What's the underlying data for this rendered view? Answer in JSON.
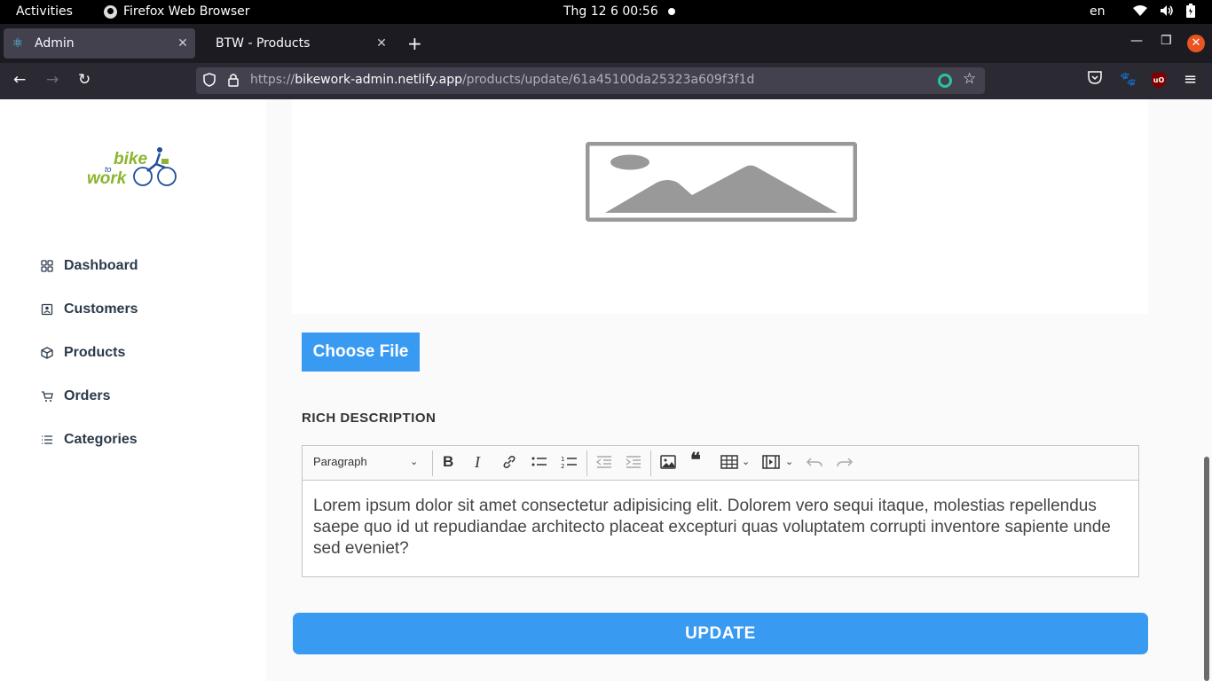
{
  "system": {
    "activities": "Activities",
    "app_name": "Firefox Web Browser",
    "clock": "Thg 12 6  00:56",
    "lang": "en"
  },
  "browser": {
    "tabs": [
      {
        "label": "Admin",
        "active": true
      },
      {
        "label": "BTW - Products",
        "active": false
      }
    ],
    "url_prefix": "https://",
    "url_host": "bikework-admin.netlify.app",
    "url_path": "/products/update/61a45100da25323a609f3f1d"
  },
  "sidebar": {
    "logo_text": "bike to work",
    "items": [
      {
        "label": "Dashboard",
        "icon": "dashboard-icon"
      },
      {
        "label": "Customers",
        "icon": "customers-icon"
      },
      {
        "label": "Products",
        "icon": "cube-icon"
      },
      {
        "label": "Orders",
        "icon": "cart-icon"
      },
      {
        "label": "Categories",
        "icon": "list-icon"
      }
    ]
  },
  "main": {
    "choose_file": "Choose File",
    "rich_label": "RICH DESCRIPTION",
    "editor": {
      "block_format": "Paragraph",
      "content": "Lorem ipsum dolor sit amet consectetur adipisicing elit. Dolorem vero sequi itaque, molestias repellendus saepe quo id ut repudiandae architecto placeat excepturi quas voluptatem corrupti inventore sapiente unde sed eveniet?"
    },
    "update_button": "UPDATE"
  },
  "colors": {
    "accent": "#399af2",
    "sidebar_text": "#2b3a4a",
    "topbar": "#000000"
  }
}
